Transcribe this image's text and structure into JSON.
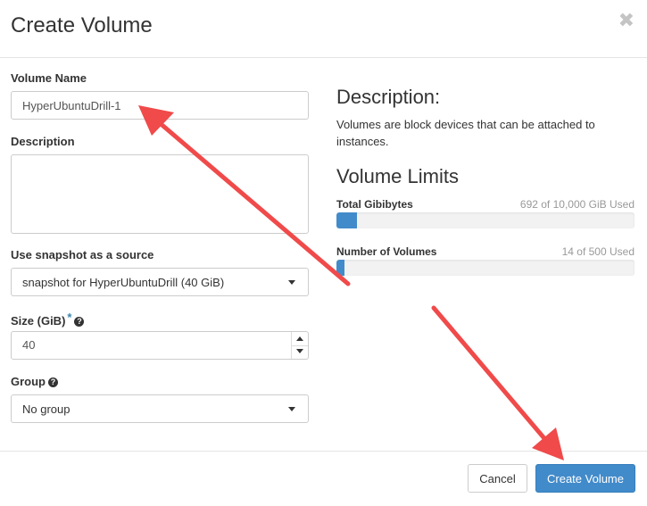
{
  "dialog": {
    "title": "Create Volume",
    "close_glyph": "✖"
  },
  "form": {
    "volume_name": {
      "label": "Volume Name",
      "value": "HyperUbuntuDrill-1"
    },
    "description": {
      "label": "Description",
      "value": ""
    },
    "snapshot_source": {
      "label": "Use snapshot as a source",
      "selected": "snapshot for HyperUbuntuDrill (40 GiB)"
    },
    "size": {
      "label": "Size (GiB)",
      "required_mark": "*",
      "value": "40"
    },
    "group": {
      "label": "Group",
      "selected": "No group"
    },
    "help_glyph": "?"
  },
  "info": {
    "description_heading": "Description:",
    "description_text": "Volumes are block devices that can be attached to instances.",
    "limits_heading": "Volume Limits",
    "limits": [
      {
        "label": "Total Gibibytes",
        "used_text": "692 of 10,000 GiB Used",
        "used": 692,
        "total": 10000
      },
      {
        "label": "Number of Volumes",
        "used_text": "14 of 500 Used",
        "used": 14,
        "total": 500
      }
    ]
  },
  "footer": {
    "cancel_label": "Cancel",
    "create_label": "Create Volume"
  },
  "colors": {
    "primary": "#428bca",
    "annotation_arrow": "#f04a4a"
  },
  "icons": {
    "close": "close-icon",
    "help": "question-circle-icon",
    "dropdown": "caret-down-icon",
    "annotation": "red-arrow-icon"
  }
}
